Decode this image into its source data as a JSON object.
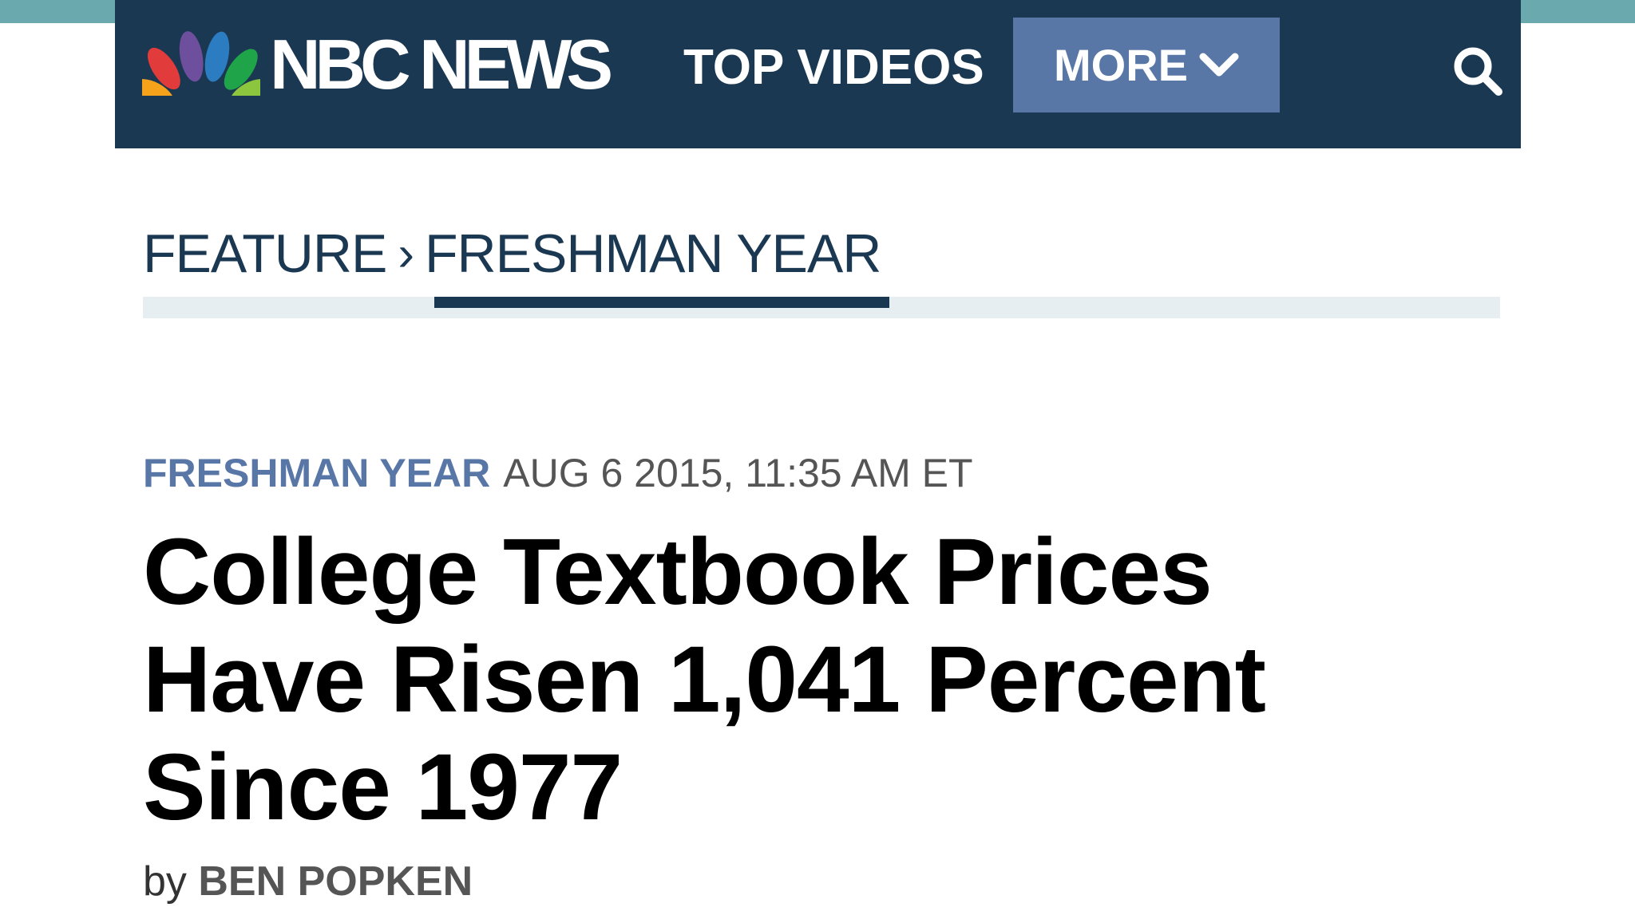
{
  "header": {
    "logo_text": "NBC NEWS",
    "nav_top_videos": "TOP VIDEOS",
    "more_label": "MORE",
    "search_icon": "search-icon",
    "colors": {
      "nav_bg": "#1b3852",
      "more_bg": "#5877a7",
      "accent": "#6aa9ad"
    }
  },
  "breadcrumb": {
    "items": [
      "FEATURE",
      "FRESHMAN YEAR"
    ],
    "separator": "›",
    "active_index": 1
  },
  "article": {
    "category": "FRESHMAN YEAR",
    "date": "AUG 6 2015, 11:35 AM ET",
    "headline": "College Textbook Prices Have Risen 1,041 Percent Since 1977",
    "byline_prefix": "by",
    "author": "BEN POPKEN"
  }
}
